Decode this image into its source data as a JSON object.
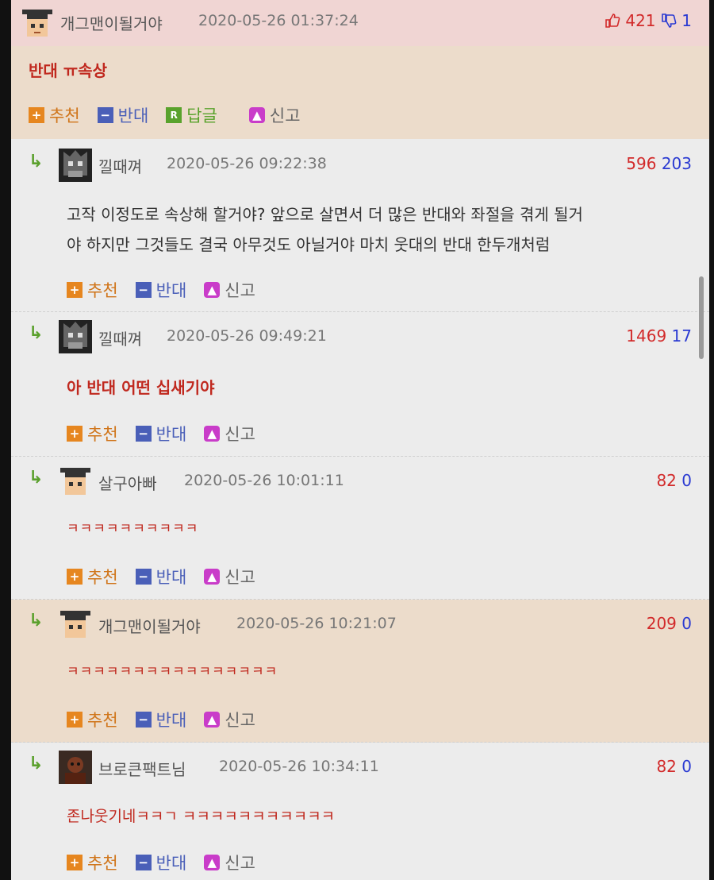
{
  "post": {
    "nick": "개그맨이될거야",
    "date": "2020-05-26 01:37:24",
    "up": "421",
    "down": "1",
    "body": "반대 ㅠ속상",
    "actions": {
      "recommend": "추천",
      "oppose": "반대",
      "reply": "답글",
      "report": "신고"
    },
    "reply_badge": "R"
  },
  "comments": [
    {
      "nick": "낄때껴",
      "date": "2020-05-26 09:22:38",
      "up": "596",
      "down": "203",
      "body": [
        "고작 이정도로 속상해 할거야? 앞으로 살면서 더 많은 반대와 좌절을 겪게 될거",
        "야 하지만 그것들도 결국 아무것도 아닐거야 마치 웃대의 반대 한두개처럼"
      ]
    },
    {
      "nick": "낄때껴",
      "date": "2020-05-26 09:49:21",
      "up": "1469",
      "down": "17",
      "body": [
        "아 반대 어떤 십새기야"
      ]
    },
    {
      "nick": "살구아빠",
      "date": "2020-05-26 10:01:11",
      "up": "82",
      "down": "0",
      "body": [
        "ㅋㅋㅋㅋㅋㅋㅋㅋㅋㅋ"
      ]
    },
    {
      "nick": "개그맨이될거야",
      "date": "2020-05-26 10:21:07",
      "up": "209",
      "down": "0",
      "body": [
        "ㅋㅋㅋㅋㅋㅋㅋㅋㅋㅋㅋㅋㅋㅋㅋㅋ"
      ]
    },
    {
      "nick": "브로큰팩트님",
      "date": "2020-05-26 10:34:11",
      "up": "82",
      "down": "0",
      "body": [
        "존나웃기네ㅋㅋㄱ ㅋㅋㅋㅋㅋㅋㅋㅋㅋㅋㅋ"
      ]
    }
  ],
  "actions": {
    "recommend": "추천",
    "oppose": "반대",
    "report": "신고"
  },
  "icons": {
    "reply": "reply-arrow-icon",
    "thumb_up": "thumbs-up-icon",
    "thumb_down": "thumbs-down-icon"
  },
  "colors": {
    "up": "#d22a2a",
    "down": "#2a3ad2",
    "accent_red": "#c0281e"
  }
}
